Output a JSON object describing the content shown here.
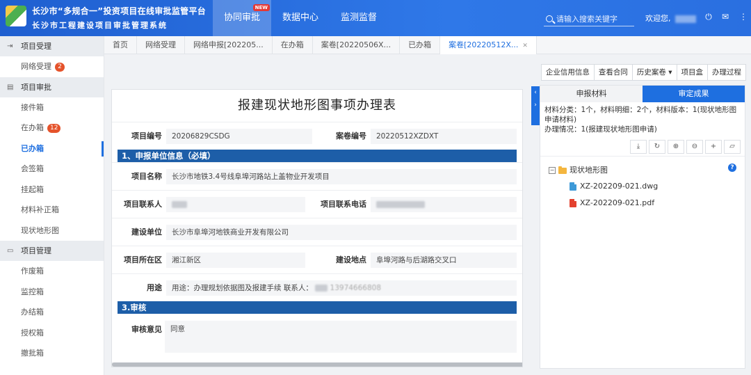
{
  "header": {
    "brand_line1": "长沙市“多规合一”投资项目在线审批监管平台",
    "brand_line2": "长沙市工程建设项目审批管理系统",
    "nav": [
      {
        "label": "协同审批",
        "active": true,
        "badge": "NEW"
      },
      {
        "label": "数据中心",
        "active": false
      },
      {
        "label": "监测监督",
        "active": false
      }
    ],
    "search_placeholder": "请输入搜索关键字",
    "welcome": "欢迎您,",
    "icons": [
      "power-icon",
      "mail-icon",
      "more-icon"
    ]
  },
  "sidebar": {
    "groups": [
      {
        "title": "项目受理",
        "icon": "receive-icon",
        "items": [
          {
            "label": "网络受理",
            "badge": "2"
          }
        ]
      },
      {
        "title": "项目审批",
        "icon": "approve-icon",
        "items": [
          {
            "label": "接件箱"
          },
          {
            "label": "在办箱",
            "badge": "12"
          },
          {
            "label": "已办箱",
            "active": true
          },
          {
            "label": "会签箱"
          },
          {
            "label": "挂起箱"
          },
          {
            "label": "材料补正箱"
          },
          {
            "label": "现状地形图"
          }
        ]
      },
      {
        "title": "项目管理",
        "icon": "manage-icon",
        "items": [
          {
            "label": "作废箱"
          },
          {
            "label": "监控箱"
          },
          {
            "label": "办结箱"
          },
          {
            "label": "授权箱"
          },
          {
            "label": "撤批箱"
          }
        ]
      }
    ]
  },
  "tabs": [
    {
      "label": "首页"
    },
    {
      "label": "网络受理"
    },
    {
      "label": "网络申报[202205..."
    },
    {
      "label": "在办箱"
    },
    {
      "label": "案卷[20220506X..."
    },
    {
      "label": "已办箱"
    },
    {
      "label": "案卷[20220512X...",
      "active": true,
      "closable": true
    }
  ],
  "form": {
    "title": "报建现状地形图事项办理表",
    "project_no_label": "项目编号",
    "project_no": "20206829CSDG",
    "case_no_label": "案卷编号",
    "case_no": "20220512XZDXT",
    "section1": "1、申报单位信息（必填）",
    "project_name_label": "项目名称",
    "project_name": "长沙市地铁3.4号线阜埠河路站上盖物业开发项目",
    "contact_label": "项目联系人",
    "contact_phone_label": "项目联系电话",
    "build_unit_label": "建设单位",
    "build_unit": "长沙市阜埠河地铁商业开发有限公司",
    "district_label": "项目所在区",
    "district": "湘江新区",
    "site_label": "建设地点",
    "site": "阜埠河路与后湖路交叉口",
    "purpose_label": "用途",
    "purpose": "用途：办理规划依据图及报建手续 联系人：",
    "purpose_phone": "13974666808",
    "section3": "3.审核",
    "review_label": "审核意见",
    "review": "同意"
  },
  "toolbar": [
    {
      "label": "企业信用信息"
    },
    {
      "label": "查看合同"
    },
    {
      "label": "历史案卷 ▾"
    },
    {
      "label": "项目盒"
    },
    {
      "label": "办理过程"
    }
  ],
  "right": {
    "tabs": [
      {
        "label": "申报材料",
        "active": false
      },
      {
        "label": "审定成果",
        "active": true
      }
    ],
    "info_line1": "材料分类：1个，材料明细：2个，材料版本：1(现状地形图申请材料)",
    "info_line2": "办理情况：1(报建现状地形图申请)",
    "tree_root": "现状地形图",
    "files": [
      {
        "name": "XZ-202209-021.dwg",
        "type": "dwg"
      },
      {
        "name": "XZ-202209-021.pdf",
        "type": "pdf"
      }
    ]
  },
  "colors": {
    "primary": "#1e6fe0",
    "section": "#1d5ea8",
    "badge": "#e5532b"
  }
}
